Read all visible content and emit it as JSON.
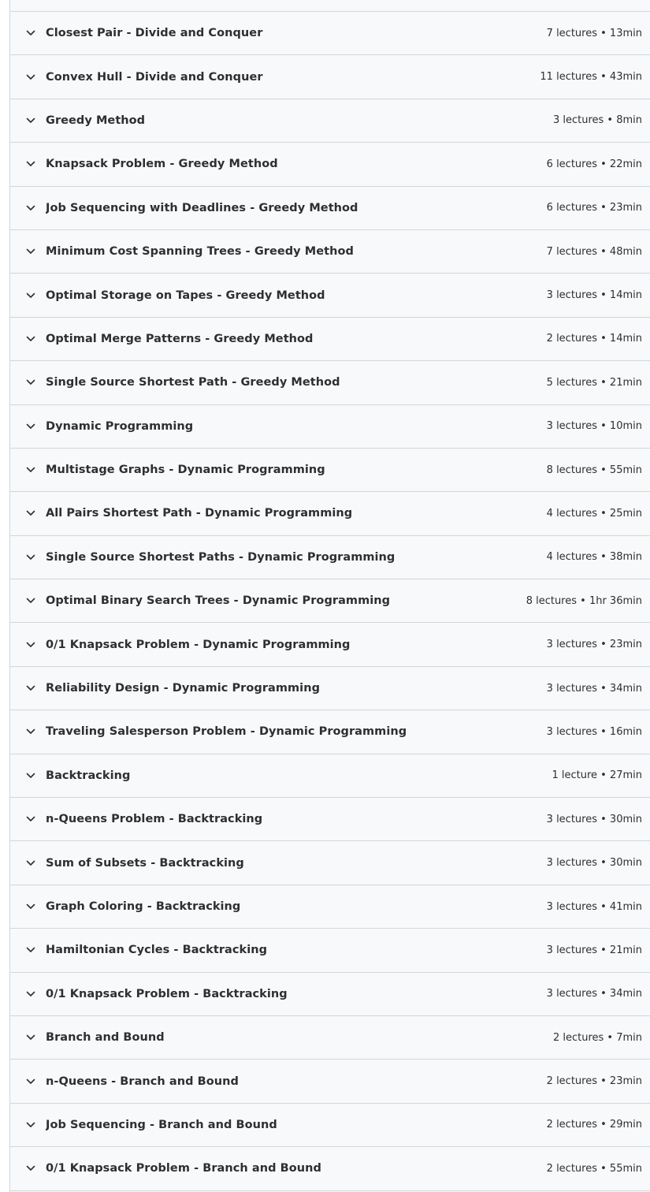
{
  "sections": [
    {
      "title": "Closest Pair - Divide and Conquer",
      "meta": "7 lectures • 13min"
    },
    {
      "title": "Convex Hull - Divide and Conquer",
      "meta": "11 lectures • 43min"
    },
    {
      "title": "Greedy Method",
      "meta": "3 lectures • 8min"
    },
    {
      "title": "Knapsack Problem - Greedy Method",
      "meta": "6 lectures • 22min"
    },
    {
      "title": "Job Sequencing with Deadlines - Greedy Method",
      "meta": "6 lectures • 23min"
    },
    {
      "title": "Minimum Cost Spanning Trees - Greedy Method",
      "meta": "7 lectures • 48min"
    },
    {
      "title": "Optimal Storage on Tapes - Greedy Method",
      "meta": "3 lectures • 14min"
    },
    {
      "title": "Optimal Merge Patterns - Greedy Method",
      "meta": "2 lectures • 14min"
    },
    {
      "title": "Single Source Shortest Path - Greedy Method",
      "meta": "5 lectures • 21min"
    },
    {
      "title": "Dynamic Programming",
      "meta": "3 lectures • 10min"
    },
    {
      "title": "Multistage Graphs - Dynamic Programming",
      "meta": "8 lectures • 55min"
    },
    {
      "title": "All Pairs Shortest Path - Dynamic Programming",
      "meta": "4 lectures • 25min"
    },
    {
      "title": "Single Source Shortest Paths - Dynamic Programming",
      "meta": "4 lectures • 38min"
    },
    {
      "title": "Optimal Binary Search Trees - Dynamic Programming",
      "meta": "8 lectures • 1hr 36min"
    },
    {
      "title": "0/1 Knapsack Problem - Dynamic Programming",
      "meta": "3 lectures • 23min"
    },
    {
      "title": "Reliability Design - Dynamic Programming",
      "meta": "3 lectures • 34min"
    },
    {
      "title": "Traveling Salesperson Problem - Dynamic Programming",
      "meta": "3 lectures • 16min"
    },
    {
      "title": "Backtracking",
      "meta": "1 lecture • 27min"
    },
    {
      "title": "n-Queens Problem - Backtracking",
      "meta": "3 lectures • 30min"
    },
    {
      "title": "Sum of Subsets - Backtracking",
      "meta": "3 lectures • 30min"
    },
    {
      "title": "Graph Coloring - Backtracking",
      "meta": "3 lectures • 41min"
    },
    {
      "title": "Hamiltonian Cycles - Backtracking",
      "meta": "3 lectures • 21min"
    },
    {
      "title": "0/1 Knapsack Problem - Backtracking",
      "meta": "3 lectures • 34min"
    },
    {
      "title": "Branch and Bound",
      "meta": "2 lectures • 7min"
    },
    {
      "title": "n-Queens - Branch and Bound",
      "meta": "2 lectures • 23min"
    },
    {
      "title": "Job Sequencing - Branch and Bound",
      "meta": "2 lectures • 29min"
    },
    {
      "title": "0/1 Knapsack Problem - Branch and Bound",
      "meta": "2 lectures • 55min"
    }
  ],
  "icons": {
    "toggle": "chevron-down-icon"
  },
  "colors": {
    "row_bg": "#f7f9fa",
    "border": "#d1d7dc",
    "text": "#2d2f31"
  }
}
